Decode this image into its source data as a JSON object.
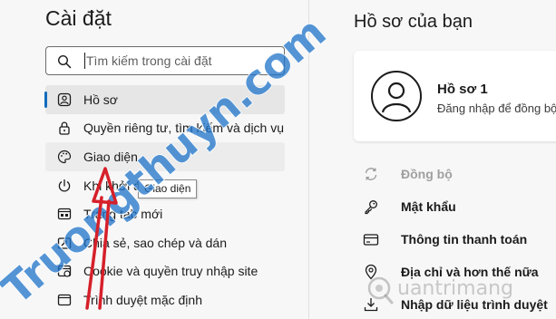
{
  "settings": {
    "title": "Cài đặt",
    "search_placeholder": "Tìm kiếm trong cài đặt"
  },
  "nav": {
    "items": [
      {
        "label": "Hồ sơ",
        "icon": "person-icon"
      },
      {
        "label": "Quyền riêng tư, tìm kiếm và dịch vụ",
        "icon": "lock-icon"
      },
      {
        "label": "Giao diện",
        "icon": "palette-icon"
      },
      {
        "label": "Khi khởi động",
        "icon": "power-icon"
      },
      {
        "label": "Trang tab mới",
        "icon": "tab-icon"
      },
      {
        "label": "Chia sẻ, sao chép và dán",
        "icon": "share-icon"
      },
      {
        "label": "Cookie và quyền truy nhập site",
        "icon": "cookie-icon"
      },
      {
        "label": "Trình duyệt mặc định",
        "icon": "browser-icon"
      }
    ],
    "selected_index": 0,
    "hover_index": 2,
    "tooltip": "Giao diện"
  },
  "profile": {
    "heading": "Hồ sơ của bạn",
    "name": "Hồ sơ 1",
    "subtitle": "Đăng nhập để đồng bộ"
  },
  "profile_items": [
    {
      "label": "Đồng bộ",
      "icon": "sync-icon",
      "disabled": true
    },
    {
      "label": "Mật khẩu",
      "icon": "key-icon",
      "disabled": false
    },
    {
      "label": "Thông tin thanh toán",
      "icon": "card-icon",
      "disabled": false
    },
    {
      "label": "Địa chỉ và hơn thế nữa",
      "icon": "location-icon",
      "disabled": false
    },
    {
      "label": "Nhập dữ liệu trình duyệt",
      "icon": "import-icon",
      "disabled": false
    }
  ],
  "watermarks": {
    "site_text": "Truongthuyn.com",
    "brand_text": "uantrimang"
  },
  "colors": {
    "accent": "#0f6cbd",
    "watermark_blue": "#1e73c8",
    "watermark_red": "#e8413a",
    "arrow_red": "#d6202a"
  }
}
